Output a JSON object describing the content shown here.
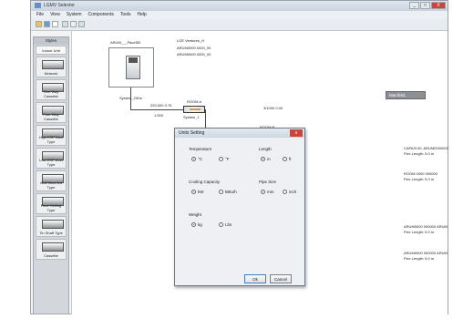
{
  "window": {
    "title": "LGMV Selector",
    "controls": [
      "_",
      "□",
      "X"
    ]
  },
  "menu": [
    "File",
    "View",
    "System",
    "Components",
    "Tools",
    "Help"
  ],
  "sidebar": {
    "header": "Styles",
    "items": [
      {
        "label": "Indoor Unit"
      },
      {
        "label": "Network"
      },
      {
        "label": "One Way Cassette"
      },
      {
        "label": "Four Way Cassette"
      },
      {
        "label": "High ESP Duct Type"
      },
      {
        "label": "Low ESP Duct Type"
      },
      {
        "label": "Wall Mounted Type"
      },
      {
        "label": "Floor Ceiling Type"
      },
      {
        "label": "Tin Shaft Type"
      },
      {
        "label": "Cassette"
      }
    ]
  },
  "canvas": {
    "outdoor_label": "ARUM___PaceSB",
    "outdoor_info": [
      "LGE Ventures_H",
      "ARUM0000 0000_00",
      "ARUM0000 0000_00"
    ],
    "system_label": "System_20Hz",
    "pipe_label_1": "220,000 0.75",
    "pipe_label_2": "1.000",
    "joint1_name": "ROOM A",
    "joint1_sub": "System_1",
    "joint2_name": "ROOM B",
    "joint2_sub": "System_2",
    "mid_pipe": "0.00,000 0.50",
    "mid_pipe2": "0.00",
    "right_label": "3/1000 0.00",
    "pipe3": "0.00,000 0.50",
    "pipe4": "0.00",
    "float_box": "Manifold..",
    "notes": [
      "CAPA/0.00, ARUM0000000",
      "Flex Length: 5.0 m",
      "ROOM 0000 000000",
      "Flex Length: 5.0 m",
      "ARUM0000 000000 ARUM",
      "Flex Length: 5.0 m",
      "ARUM0000 000000 ARUM",
      "Flex Length: 5.0 m"
    ]
  },
  "dialog": {
    "title": "Units Setting",
    "temperature": {
      "label": "Temperature",
      "options": [
        "°C",
        "°F"
      ],
      "selected": 0
    },
    "length": {
      "label": "Length",
      "options": [
        "m",
        "ft"
      ],
      "selected": 0
    },
    "cooling": {
      "label": "Cooling Capacity",
      "options": [
        "kW",
        "kBtu/h"
      ],
      "selected": 0
    },
    "pipe": {
      "label": "Pipe Size",
      "options": [
        "mm",
        "inch"
      ],
      "selected": 0
    },
    "weight": {
      "label": "Weight",
      "options": [
        "kg",
        "Lbs"
      ],
      "selected": 0
    },
    "ok": "Ok",
    "cancel": "Cancel"
  }
}
